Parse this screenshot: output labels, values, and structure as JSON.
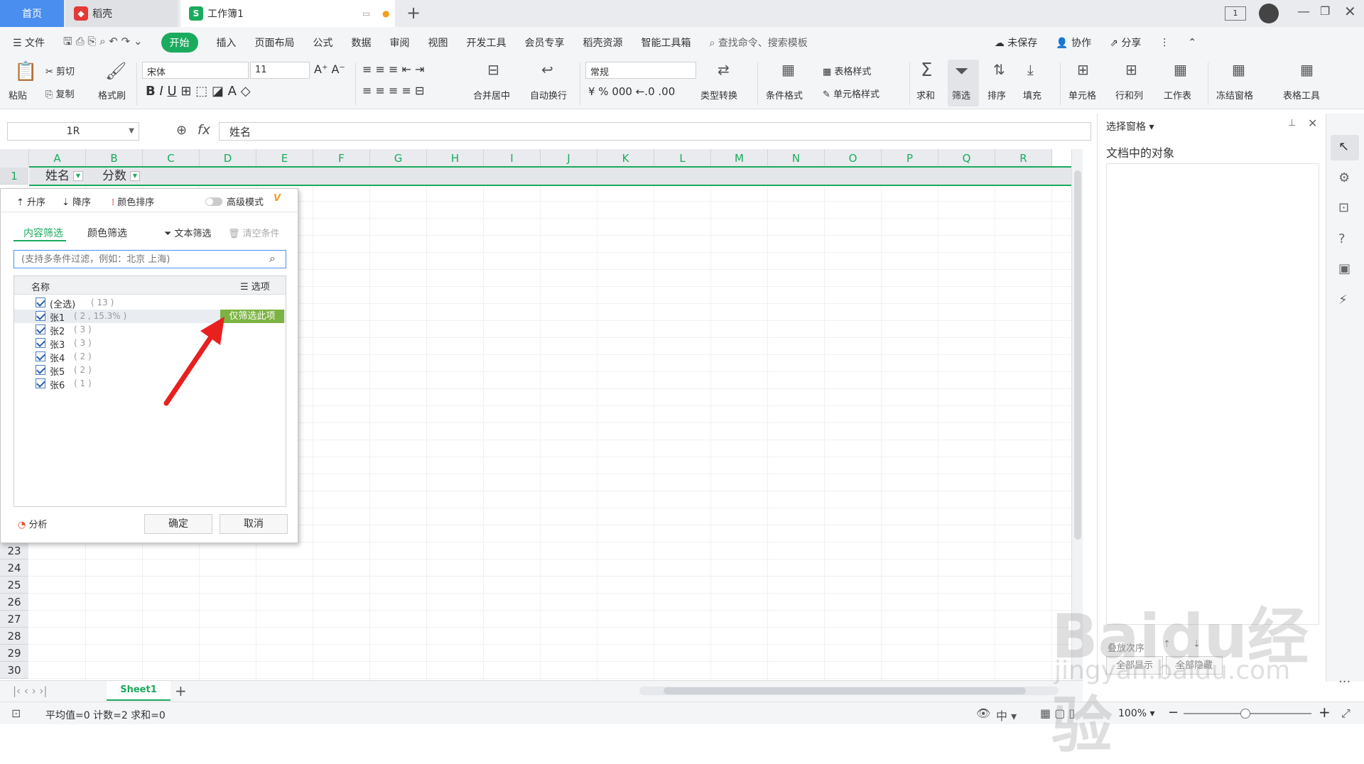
{
  "tabs": {
    "home": "首页",
    "daoke": "稻壳",
    "doc": "工作簿1"
  },
  "menu": {
    "file": "文件",
    "items": [
      "开始",
      "插入",
      "页面布局",
      "公式",
      "数据",
      "审阅",
      "视图",
      "开发工具",
      "会员专享",
      "稻壳资源",
      "智能工具箱"
    ],
    "search": "查找命令、搜索模板",
    "unsaved": "未保存",
    "collab": "协作",
    "share": "分享"
  },
  "ribbon": {
    "paste": "粘贴",
    "cut": "剪切",
    "copy": "复制",
    "format_painter": "格式刷",
    "font_name": "宋体",
    "font_size": "11",
    "merge_center": "合并居中",
    "auto_wrap": "自动换行",
    "number_format": "常规",
    "type_convert": "类型转换",
    "cond_format": "条件格式",
    "table_style": "表格样式",
    "cell_style": "单元格样式",
    "sum": "求和",
    "filter": "筛选",
    "sort": "排序",
    "fill": "填充",
    "cell": "单元格",
    "row_col": "行和列",
    "worksheet": "工作表",
    "freeze": "冻结窗格",
    "table_tool": "表格工具"
  },
  "formula_bar": {
    "name_box": "1R",
    "fx": "fx",
    "content": "姓名"
  },
  "grid": {
    "columns": [
      "A",
      "B",
      "C",
      "D",
      "E",
      "F",
      "G",
      "H",
      "I",
      "J",
      "K",
      "L",
      "M",
      "N",
      "O",
      "P",
      "Q",
      "R"
    ],
    "header_cells": [
      "姓名",
      "分数"
    ],
    "visible_rows": [
      "1",
      "23",
      "24",
      "25",
      "26",
      "27",
      "28",
      "29",
      "30"
    ]
  },
  "filter_popup": {
    "asc": "升序",
    "desc": "降序",
    "color_sort": "颜色排序",
    "advanced": "高级模式",
    "tab_content": "内容筛选",
    "tab_color": "颜色筛选",
    "text_filter": "文本筛选",
    "clear": "清空条件",
    "search_placeholder": "(支持多条件过滤，例如：北京 上海)",
    "list_header": "名称",
    "options": "选项",
    "items": [
      {
        "label": "(全选)",
        "count": "( 13 )"
      },
      {
        "label": "张1",
        "count": "( 2 , 15.3% )"
      },
      {
        "label": "张2",
        "count": "( 3 )"
      },
      {
        "label": "张3",
        "count": "( 3 )"
      },
      {
        "label": "张4",
        "count": "( 2 )"
      },
      {
        "label": "张5",
        "count": "( 2 )"
      },
      {
        "label": "张6",
        "count": "( 1 )"
      }
    ],
    "only_this": "仅筛选此项",
    "analysis": "分析",
    "ok": "确定",
    "cancel": "取消"
  },
  "right_pane": {
    "title": "选择窗格",
    "objects": "文档中的对象",
    "zorder": "叠放次序",
    "show_all": "全部显示",
    "hide_all": "全部隐藏"
  },
  "sheetbar": {
    "sheet": "Sheet1"
  },
  "status": {
    "summary": "平均值=0  计数=2  求和=0",
    "zoom": "100%"
  },
  "watermark": {
    "brand": "Baidu经验",
    "url": "jingyan.baidu.com"
  },
  "colors": {
    "accent": "#1aab5e",
    "tab_blue": "#4a8ef0",
    "arrow": "#e8201e"
  }
}
